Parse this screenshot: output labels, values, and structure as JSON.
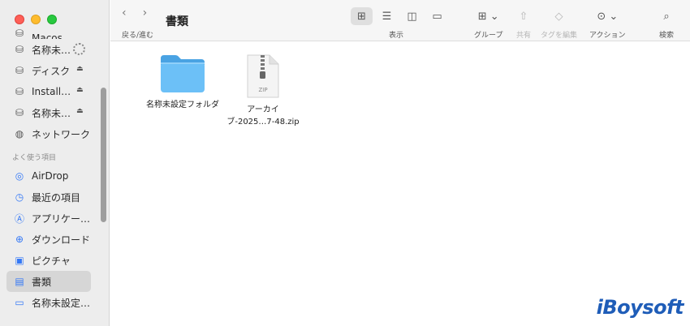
{
  "toolbar": {
    "title": "書類",
    "back_forward_caption": "戻る/進む",
    "back_icon": "‹",
    "forward_icon": "›",
    "view_caption": "表示",
    "group_label": "グループ",
    "share_label": "共有",
    "tags_label": "タグを編集",
    "action_label": "アクション",
    "search_label": "検索"
  },
  "sidebar": {
    "partial_top_label": "Macos",
    "locations": [
      {
        "label": "名称未…",
        "icon": "drive-icon",
        "state": "loading"
      },
      {
        "label": "ディスク",
        "icon": "drive-icon",
        "state": "eject"
      },
      {
        "label": "Install…",
        "icon": "drive-icon",
        "state": "eject"
      },
      {
        "label": "名称未…",
        "icon": "drive-icon",
        "state": "eject"
      },
      {
        "label": "ネットワーク",
        "icon": "globe-icon",
        "state": ""
      }
    ],
    "favorites_heading": "よく使う項目",
    "favorites": [
      {
        "label": "AirDrop",
        "icon": "airdrop-icon"
      },
      {
        "label": "最近の項目",
        "icon": "clock-icon"
      },
      {
        "label": "アプリケー…",
        "icon": "apps-icon"
      },
      {
        "label": "ダウンロード",
        "icon": "download-icon"
      },
      {
        "label": "ピクチャ",
        "icon": "photo-icon"
      },
      {
        "label": "書類",
        "icon": "document-icon",
        "selected": true
      },
      {
        "label": "名称未設定…",
        "icon": "folder-icon"
      }
    ]
  },
  "files": [
    {
      "name": "名称未設定フォルダ",
      "type": "folder"
    },
    {
      "name_line1": "アーカイ",
      "name_line2": "ブ-2025…7-48.zip",
      "badge": "ZIP",
      "type": "zip"
    }
  ],
  "watermark": "iBoysoft",
  "colors": {
    "accent": "#3478f6",
    "folder": "#5ab5f3",
    "selection": "#d6d6d6",
    "watermark": "#1f5db8"
  }
}
